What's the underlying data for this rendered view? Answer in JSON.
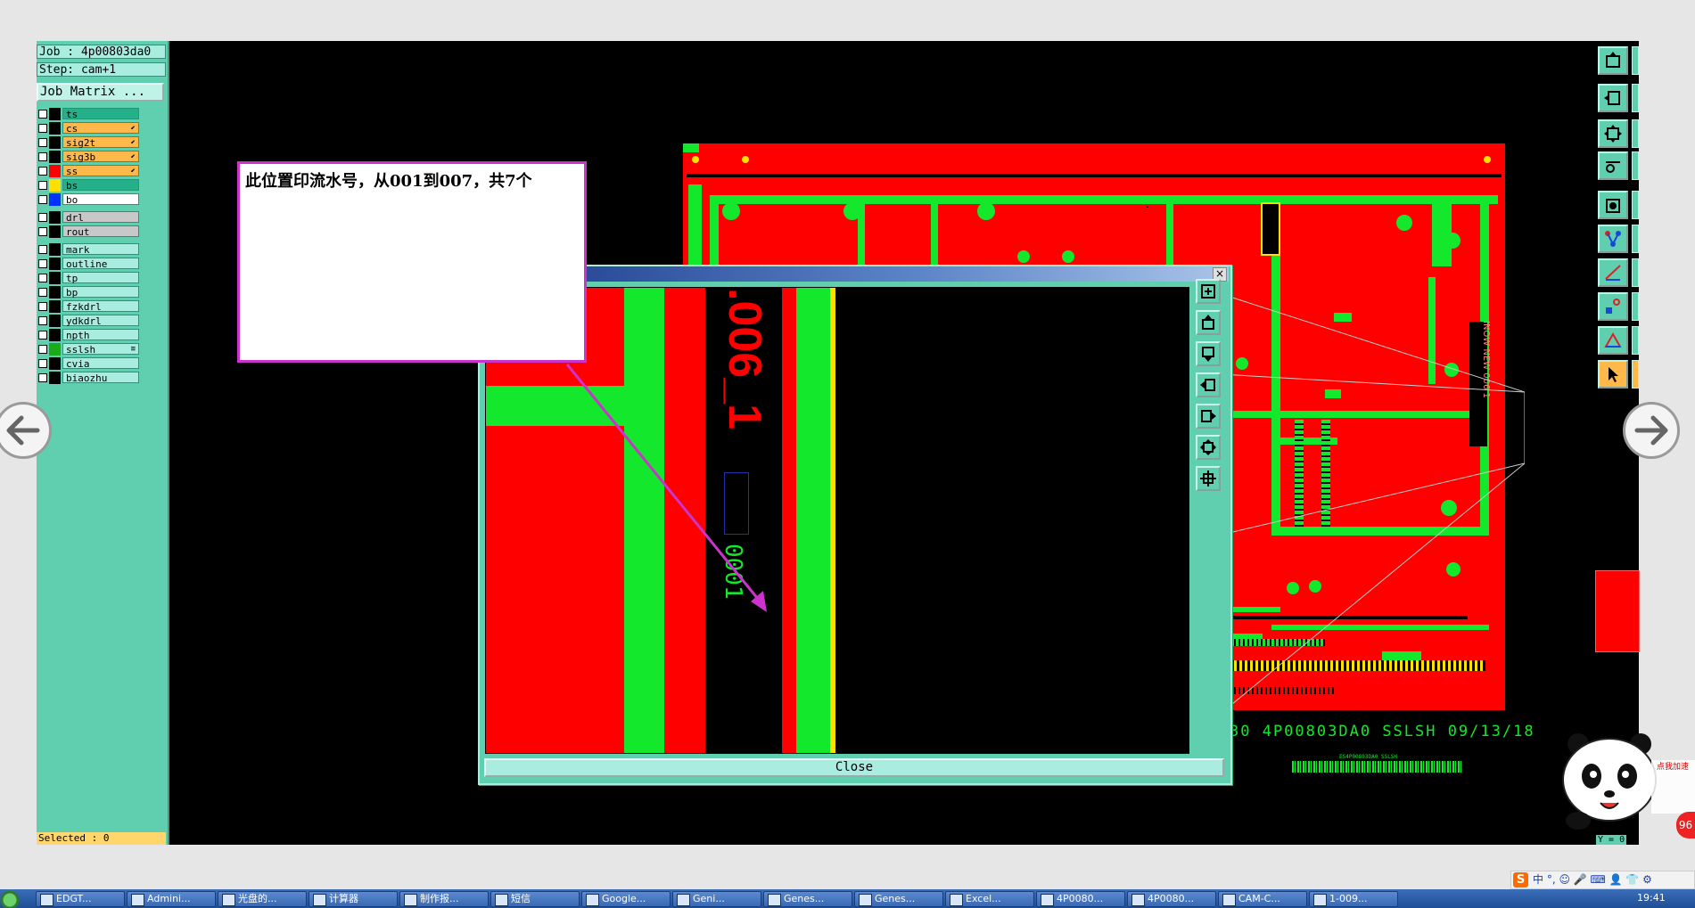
{
  "left_panel": {
    "job_line": "Job : 4p00803da0",
    "step_line": "Step: cam+1",
    "job_matrix_label": "Job Matrix ...",
    "layers": [
      {
        "name": "ts",
        "color": "#000000",
        "bg": "#26b08a",
        "actions": ""
      },
      {
        "name": "cs",
        "color": "#000000",
        "bg": "#ffb84a",
        "actions": "⬋"
      },
      {
        "name": "sig2t",
        "color": "#000000",
        "bg": "#ffb84a",
        "actions": "⬋"
      },
      {
        "name": "sig3b",
        "color": "#000000",
        "bg": "#ffb84a",
        "actions": "⬋"
      },
      {
        "name": "ss",
        "color": "#ff0000",
        "bg": "#ffb84a",
        "actions": "⬋"
      },
      {
        "name": "bs",
        "color": "#ffe000",
        "bg": "#26b08a",
        "actions": ""
      },
      {
        "name": "bo",
        "color": "#0033ff",
        "bg": "#ffffff",
        "actions": ""
      },
      {
        "name": "drl",
        "color": "#000000",
        "bg": "#c8c8c8",
        "actions": ""
      },
      {
        "name": "rout",
        "color": "#000000",
        "bg": "#c8c8c8",
        "actions": ""
      },
      {
        "name": "mark",
        "color": "#000000",
        "bg": "#a8ede0",
        "actions": ""
      },
      {
        "name": "outline",
        "color": "#000000",
        "bg": "#a8ede0",
        "actions": ""
      },
      {
        "name": "tp",
        "color": "#000000",
        "bg": "#a8ede0",
        "actions": ""
      },
      {
        "name": "bp",
        "color": "#000000",
        "bg": "#a8ede0",
        "actions": ""
      },
      {
        "name": "fzkdrl",
        "color": "#000000",
        "bg": "#a8ede0",
        "actions": ""
      },
      {
        "name": "ydkdrl",
        "color": "#000000",
        "bg": "#a8ede0",
        "actions": ""
      },
      {
        "name": "npth",
        "color": "#000000",
        "bg": "#a8ede0",
        "actions": ""
      },
      {
        "name": "sslsh",
        "color": "#1aaa1a",
        "bg": "#a8ede0",
        "actions": "≡"
      },
      {
        "name": "cvia",
        "color": "#000000",
        "bg": "#a8ede0",
        "actions": ""
      },
      {
        "name": "biaozhu",
        "color": "#000000",
        "bg": "#a8ede0",
        "actions": ""
      }
    ],
    "selected_status": "Selected : 0"
  },
  "callout": {
    "text": "此位置印流水号，从001到007，共7个"
  },
  "popup": {
    "close_button_label": "Close",
    "close_x": "×",
    "zoomed_text_large": ".006_1",
    "zoomed_text_serial": "0001"
  },
  "board": {
    "bottom_label": "30 4P00803DA0 SSLSH 09/13/18",
    "barcode_caption": "ES4P00803DA0 SSLSH",
    "side_text": "INOW NEW 006 1"
  },
  "coord_label": "Y = 0",
  "ime": {
    "logo": "S",
    "text": "中 °, ☺ 🎤 ⌨ 👤 👕 ⚙"
  },
  "panda": {
    "badge": "点我加速",
    "number": "96"
  },
  "taskbar": {
    "items": [
      "EDGT...",
      "Admini...",
      "光盘的...",
      "计算器",
      "制作报...",
      "短信",
      "Google...",
      "Geni...",
      "Genes...",
      "Genes...",
      "Excel...",
      "4P0080...",
      "4P0080...",
      "CAM-C...",
      "1-009..."
    ],
    "clock": "19:41"
  },
  "colors": {
    "copper_red": "#ff0000",
    "mask_green": "#13e82c",
    "panel_teal": "#5fcfb0",
    "callout_border": "#cc33cc"
  },
  "icons": [
    "prev-arrow-icon",
    "next-arrow-icon",
    "close-icon",
    "zoom-in-icon",
    "zoom-out-icon",
    "fit-icon",
    "pan-icon",
    "pointer-icon"
  ]
}
